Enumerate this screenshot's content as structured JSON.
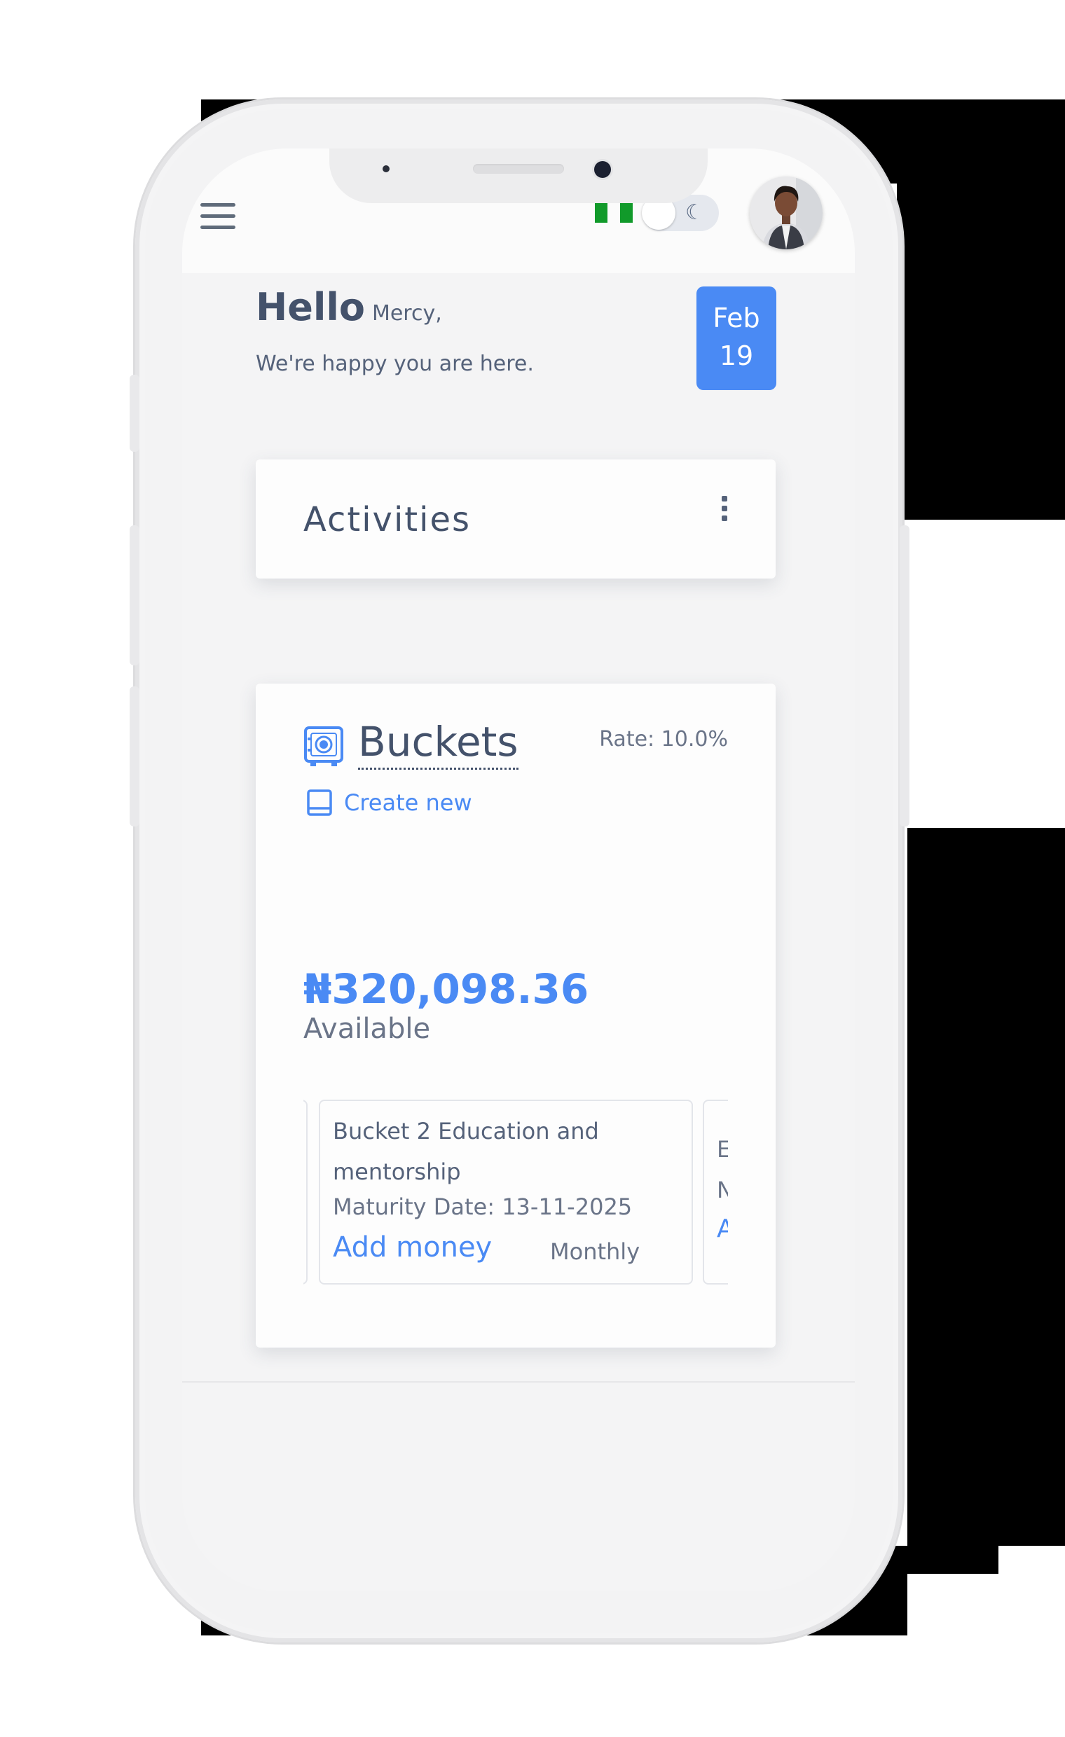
{
  "header": {
    "flag_name": "nigeria-flag",
    "theme_toggle_icon": "☾",
    "avatar_name": "user-avatar"
  },
  "greeting": {
    "hello": "Hello",
    "name": "Mercy,",
    "tagline": "We're happy you are here."
  },
  "date_badge": {
    "month": "Feb",
    "day": "19"
  },
  "activities": {
    "title": "Activities"
  },
  "buckets": {
    "title": "Buckets",
    "rate": "Rate: 10.0%",
    "create_label": "Create new",
    "amount": "₦320,098.36",
    "amount_label": "Available",
    "items": [
      {
        "name": "Bucket 2 Education and mentorship",
        "maturity": "Maturity Date: 13-11-2025",
        "action": "Add money",
        "frequency": "Monthly"
      }
    ],
    "next_peek": {
      "line1": "E",
      "line2": "N",
      "line3": "A"
    }
  },
  "colors": {
    "accent": "#4a8af4",
    "text": "#44526b",
    "muted": "#6a7488",
    "flag_green": "#119a2a"
  }
}
